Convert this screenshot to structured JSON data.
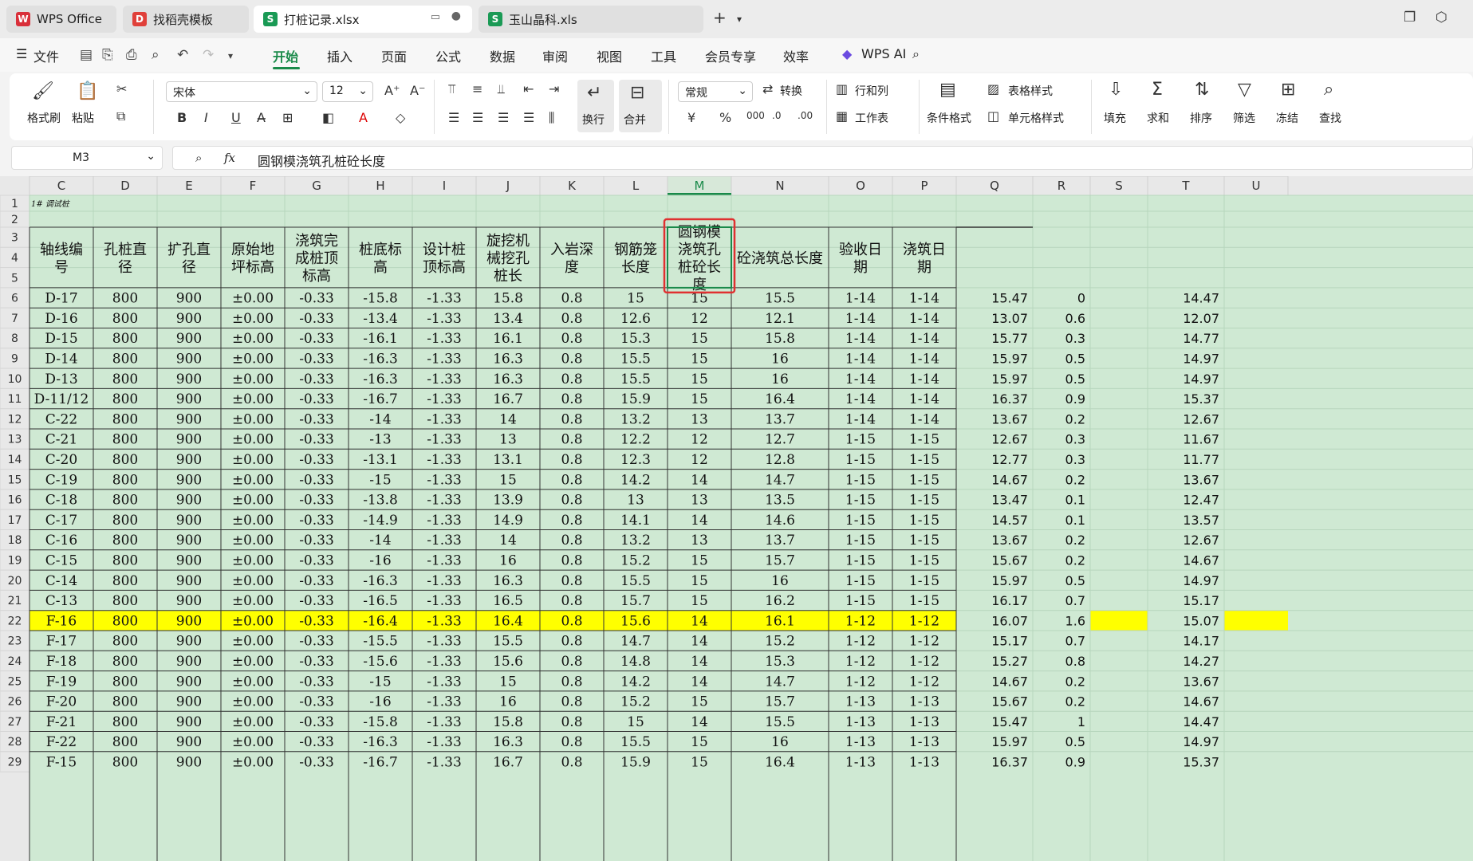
{
  "tabs": [
    {
      "label": "WPS Office",
      "icon": "wps-logo-icon",
      "color": "#d9303a",
      "glyph": "W"
    },
    {
      "label": "找稻壳模板",
      "icon": "docer-icon",
      "color": "#e0403a",
      "glyph": "D"
    },
    {
      "label": "打桩记录.xlsx",
      "icon": "spreadsheet-icon",
      "color": "#1a9a55",
      "glyph": "S"
    },
    {
      "label": "玉山晶科.xls",
      "icon": "spreadsheet-icon",
      "color": "#1a9a55",
      "glyph": "S"
    }
  ],
  "menu": {
    "file": "文件",
    "items": [
      "开始",
      "插入",
      "页面",
      "公式",
      "数据",
      "审阅",
      "视图",
      "工具",
      "会员专享",
      "效率"
    ],
    "ai": "WPS AI"
  },
  "ribbon": {
    "format_painter": "格式刷",
    "paste": "粘贴",
    "font_name": "宋体",
    "font_size": "12",
    "bold": "B",
    "italic": "I",
    "underline": "U",
    "wrap": "换行",
    "merge": "合并",
    "number_format": "常规",
    "convert": "转换",
    "rowcol": "行和列",
    "worksheet": "工作表",
    "cond_format": "条件格式",
    "table_style": "表格样式",
    "cell_style": "单元格样式",
    "fill": "填充",
    "sum": "求和",
    "sort": "排序",
    "filter": "筛选",
    "freeze": "冻结",
    "find": "查找",
    "currency": "¥",
    "percent": "%"
  },
  "formula_bar": {
    "name_box": "M3",
    "fx": "fx",
    "content": "圆钢模浇筑孔桩砼长度"
  },
  "grid": {
    "columns": [
      "C",
      "D",
      "E",
      "F",
      "G",
      "H",
      "I",
      "J",
      "K",
      "L",
      "M",
      "N",
      "O",
      "P",
      "Q",
      "R",
      "S",
      "T",
      "U"
    ],
    "selected_column": "M",
    "row_numbers": [
      "1",
      "2",
      "3",
      "4",
      "5",
      "6",
      "7",
      "8",
      "9",
      "10",
      "11",
      "12",
      "13",
      "14",
      "15",
      "16",
      "17",
      "18",
      "19",
      "20",
      "21",
      "22",
      "23",
      "24",
      "25",
      "26",
      "27",
      "28",
      "29"
    ],
    "title_note": "1# 调试桩",
    "headers": [
      "轴线编号",
      "孔桩直径",
      "扩孔直径",
      "原始地坪标高",
      "浇筑完成桩顶标高",
      "桩底标高",
      "设计桩顶标高",
      "旋挖机械挖孔桩长",
      "入岩深度",
      "钢筋笼长度",
      "圆钢模浇筑孔桩砼长度",
      "砼浇筑总长度",
      "验收日期",
      "浇筑日期"
    ],
    "rows": [
      [
        "D-17",
        "800",
        "900",
        "±0.00",
        "-0.33",
        "-15.8",
        "-1.33",
        "15.8",
        "0.8",
        "15",
        "15",
        "15.5",
        "1-14",
        "1-14",
        "15.47",
        "0",
        "",
        "14.47"
      ],
      [
        "D-16",
        "800",
        "900",
        "±0.00",
        "-0.33",
        "-13.4",
        "-1.33",
        "13.4",
        "0.8",
        "12.6",
        "12",
        "12.1",
        "1-14",
        "1-14",
        "13.07",
        "0.6",
        "",
        "12.07"
      ],
      [
        "D-15",
        "800",
        "900",
        "±0.00",
        "-0.33",
        "-16.1",
        "-1.33",
        "16.1",
        "0.8",
        "15.3",
        "15",
        "15.8",
        "1-14",
        "1-14",
        "15.77",
        "0.3",
        "",
        "14.77"
      ],
      [
        "D-14",
        "800",
        "900",
        "±0.00",
        "-0.33",
        "-16.3",
        "-1.33",
        "16.3",
        "0.8",
        "15.5",
        "15",
        "16",
        "1-14",
        "1-14",
        "15.97",
        "0.5",
        "",
        "14.97"
      ],
      [
        "D-13",
        "800",
        "900",
        "±0.00",
        "-0.33",
        "-16.3",
        "-1.33",
        "16.3",
        "0.8",
        "15.5",
        "15",
        "16",
        "1-14",
        "1-14",
        "15.97",
        "0.5",
        "",
        "14.97"
      ],
      [
        "D-11/12",
        "800",
        "900",
        "±0.00",
        "-0.33",
        "-16.7",
        "-1.33",
        "16.7",
        "0.8",
        "15.9",
        "15",
        "16.4",
        "1-14",
        "1-14",
        "16.37",
        "0.9",
        "",
        "15.37"
      ],
      [
        "C-22",
        "800",
        "900",
        "±0.00",
        "-0.33",
        "-14",
        "-1.33",
        "14",
        "0.8",
        "13.2",
        "13",
        "13.7",
        "1-14",
        "1-14",
        "13.67",
        "0.2",
        "",
        "12.67"
      ],
      [
        "C-21",
        "800",
        "900",
        "±0.00",
        "-0.33",
        "-13",
        "-1.33",
        "13",
        "0.8",
        "12.2",
        "12",
        "12.7",
        "1-15",
        "1-15",
        "12.67",
        "0.3",
        "",
        "11.67"
      ],
      [
        "C-20",
        "800",
        "900",
        "±0.00",
        "-0.33",
        "-13.1",
        "-1.33",
        "13.1",
        "0.8",
        "12.3",
        "12",
        "12.8",
        "1-15",
        "1-15",
        "12.77",
        "0.3",
        "",
        "11.77"
      ],
      [
        "C-19",
        "800",
        "900",
        "±0.00",
        "-0.33",
        "-15",
        "-1.33",
        "15",
        "0.8",
        "14.2",
        "14",
        "14.7",
        "1-15",
        "1-15",
        "14.67",
        "0.2",
        "",
        "13.67"
      ],
      [
        "C-18",
        "800",
        "900",
        "±0.00",
        "-0.33",
        "-13.8",
        "-1.33",
        "13.9",
        "0.8",
        "13",
        "13",
        "13.5",
        "1-15",
        "1-15",
        "13.47",
        "0.1",
        "",
        "12.47"
      ],
      [
        "C-17",
        "800",
        "900",
        "±0.00",
        "-0.33",
        "-14.9",
        "-1.33",
        "14.9",
        "0.8",
        "14.1",
        "14",
        "14.6",
        "1-15",
        "1-15",
        "14.57",
        "0.1",
        "",
        "13.57"
      ],
      [
        "C-16",
        "800",
        "900",
        "±0.00",
        "-0.33",
        "-14",
        "-1.33",
        "14",
        "0.8",
        "13.2",
        "13",
        "13.7",
        "1-15",
        "1-15",
        "13.67",
        "0.2",
        "",
        "12.67"
      ],
      [
        "C-15",
        "800",
        "900",
        "±0.00",
        "-0.33",
        "-16",
        "-1.33",
        "16",
        "0.8",
        "15.2",
        "15",
        "15.7",
        "1-15",
        "1-15",
        "15.67",
        "0.2",
        "",
        "14.67"
      ],
      [
        "C-14",
        "800",
        "900",
        "±0.00",
        "-0.33",
        "-16.3",
        "-1.33",
        "16.3",
        "0.8",
        "15.5",
        "15",
        "16",
        "1-15",
        "1-15",
        "15.97",
        "0.5",
        "",
        "14.97"
      ],
      [
        "C-13",
        "800",
        "900",
        "±0.00",
        "-0.33",
        "-16.5",
        "-1.33",
        "16.5",
        "0.8",
        "15.7",
        "15",
        "16.2",
        "1-15",
        "1-15",
        "16.17",
        "0.7",
        "",
        "15.17"
      ],
      [
        "F-16",
        "800",
        "900",
        "±0.00",
        "-0.33",
        "-16.4",
        "-1.33",
        "16.4",
        "0.8",
        "15.6",
        "14",
        "16.1",
        "1-12",
        "1-12",
        "16.07",
        "1.6",
        "",
        "15.07"
      ],
      [
        "F-17",
        "800",
        "900",
        "±0.00",
        "-0.33",
        "-15.5",
        "-1.33",
        "15.5",
        "0.8",
        "14.7",
        "14",
        "15.2",
        "1-12",
        "1-12",
        "15.17",
        "0.7",
        "",
        "14.17"
      ],
      [
        "F-18",
        "800",
        "900",
        "±0.00",
        "-0.33",
        "-15.6",
        "-1.33",
        "15.6",
        "0.8",
        "14.8",
        "14",
        "15.3",
        "1-12",
        "1-12",
        "15.27",
        "0.8",
        "",
        "14.27"
      ],
      [
        "F-19",
        "800",
        "900",
        "±0.00",
        "-0.33",
        "-15",
        "-1.33",
        "15",
        "0.8",
        "14.2",
        "14",
        "14.7",
        "1-12",
        "1-12",
        "14.67",
        "0.2",
        "",
        "13.67"
      ],
      [
        "F-20",
        "800",
        "900",
        "±0.00",
        "-0.33",
        "-16",
        "-1.33",
        "16",
        "0.8",
        "15.2",
        "15",
        "15.7",
        "1-13",
        "1-13",
        "15.67",
        "0.2",
        "",
        "14.67"
      ],
      [
        "F-21",
        "800",
        "900",
        "±0.00",
        "-0.33",
        "-15.8",
        "-1.33",
        "15.8",
        "0.8",
        "15",
        "14",
        "15.5",
        "1-13",
        "1-13",
        "15.47",
        "1",
        "",
        "14.47"
      ],
      [
        "F-22",
        "800",
        "900",
        "±0.00",
        "-0.33",
        "-16.3",
        "-1.33",
        "16.3",
        "0.8",
        "15.5",
        "15",
        "16",
        "1-13",
        "1-13",
        "15.97",
        "0.5",
        "",
        "14.97"
      ],
      [
        "F-15",
        "800",
        "900",
        "±0.00",
        "-0.33",
        "-16.7",
        "-1.33",
        "16.7",
        "0.8",
        "15.9",
        "15",
        "16.4",
        "1-13",
        "1-13",
        "16.37",
        "0.9",
        "",
        "15.37"
      ]
    ],
    "highlight_row_index": 16,
    "colors": {
      "cell_bg": "#cfe9d3",
      "yellow": "#ffff00",
      "header_bg": "#e8e8e8",
      "selected_header": "#d7e8d9",
      "accent": "#1a8a4a",
      "red_box": "#e03030"
    }
  }
}
